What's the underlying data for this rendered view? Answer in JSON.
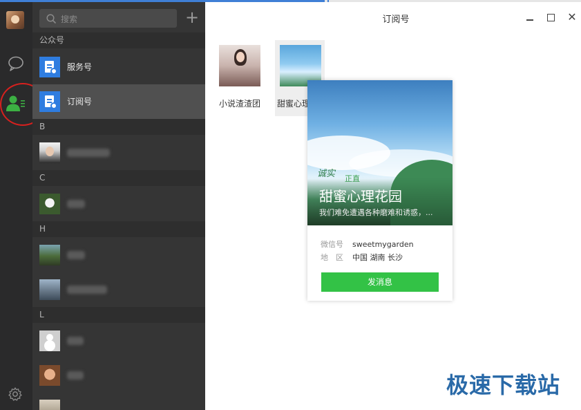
{
  "sidebar": {
    "icons": [
      "user-avatar",
      "chat-icon",
      "contacts-icon",
      "settings-icon"
    ],
    "active": "contacts-icon"
  },
  "list": {
    "search_placeholder": "搜索",
    "add_label": "+",
    "groups": [
      {
        "header": "公众号"
      },
      {
        "header": "B"
      },
      {
        "header": "C"
      },
      {
        "header": "H"
      },
      {
        "header": "L"
      }
    ],
    "official": [
      {
        "label": "服务号"
      },
      {
        "label": "订阅号",
        "selected": true
      }
    ]
  },
  "window": {
    "title": "订阅号",
    "close_label": "✕"
  },
  "cards": [
    {
      "name": "小说渣渣团"
    },
    {
      "name": "甜蜜心理",
      "selected": true
    }
  ],
  "popup": {
    "name": "甜蜜心理花园",
    "desc": "我们难免遭遇各种磨难和诱惑，...",
    "deco_a": "诚实",
    "deco_b": "正直",
    "wechat_label": "微信号",
    "wechat_value": "sweetmygarden",
    "region_label": "地　区",
    "region_value": "中国 湖南 长沙",
    "send_label": "发消息"
  },
  "watermark": "极速下载站",
  "colors": {
    "accent": "#3f7fd6",
    "active_icon": "#3cb043",
    "send_button": "#33c246",
    "highlight_ring": "#d8201e"
  }
}
